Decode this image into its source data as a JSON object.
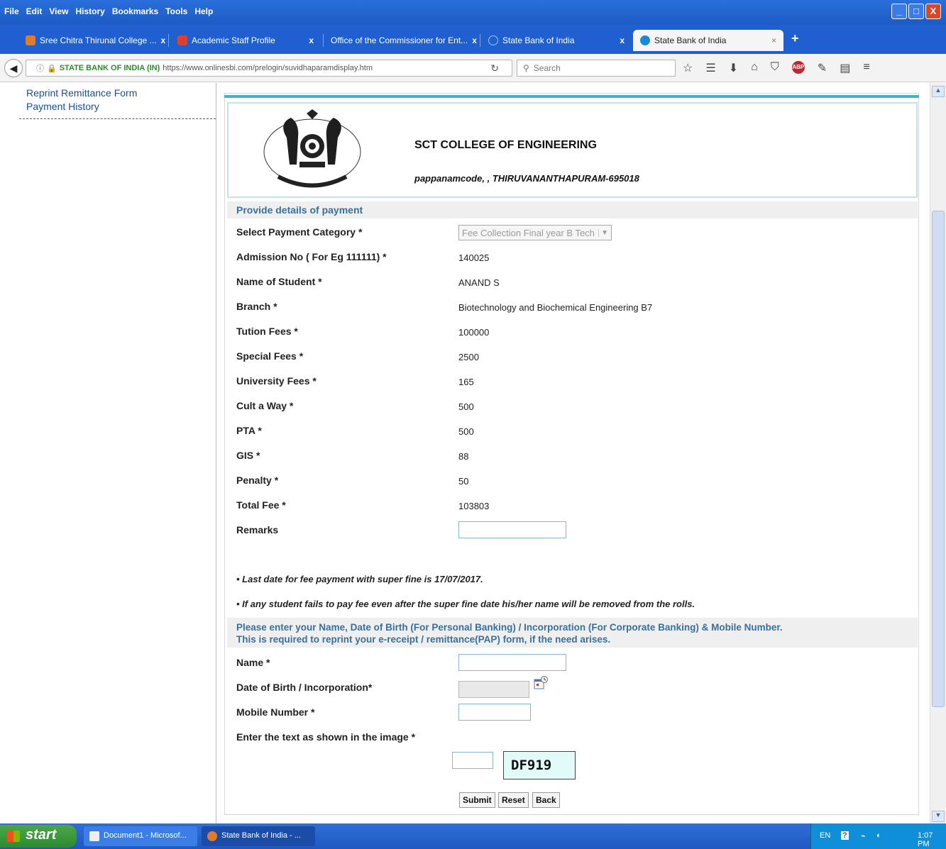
{
  "browser": {
    "menu": [
      "File",
      "Edit",
      "View",
      "History",
      "Bookmarks",
      "Tools",
      "Help"
    ],
    "tabs": [
      {
        "label": "Sree Chitra Thirunal College ...",
        "icon_color": "#e07b2a",
        "active": false
      },
      {
        "label": "Academic Staff Profile",
        "icon_color": "#e0402a",
        "active": false
      },
      {
        "label": "Office of the Commissioner for Ent...",
        "icon_color": "",
        "active": false
      },
      {
        "label": "State Bank of India",
        "icon_color": "#2a6fdc",
        "active": false
      },
      {
        "label": "State Bank of India",
        "icon_color": "#1a8ad8",
        "active": true
      }
    ],
    "site_identity": "STATE BANK OF INDIA (IN)",
    "url": "https://www.onlinesbi.com/prelogin/suvidhaparamdisplay.htm",
    "search_placeholder": "Search",
    "abp_label": "ABP"
  },
  "sidebar": {
    "links": [
      "Reprint Remittance Form",
      "Payment History"
    ]
  },
  "header": {
    "college_name": "SCT COLLEGE OF ENGINEERING",
    "address": "pappanamcode, , THIRUVANANTHAPURAM-695018"
  },
  "payment": {
    "section_title": "Provide details of payment",
    "category_label": "Select Payment Category *",
    "category_value": "Fee Collection Final year B Tech",
    "fields": [
      {
        "label": "Admission No ( For Eg 111111) *",
        "value": "140025"
      },
      {
        "label": "Name of Student *",
        "value": "ANAND S"
      },
      {
        "label": "Branch *",
        "value": "Biotechnology and Biochemical Engineering B7"
      },
      {
        "label": "Tution Fees *",
        "value": "100000"
      },
      {
        "label": "Special Fees *",
        "value": "2500"
      },
      {
        "label": "University Fees *",
        "value": "165"
      },
      {
        "label": "Cult a Way *",
        "value": "500"
      },
      {
        "label": "PTA *",
        "value": "500"
      },
      {
        "label": "GIS *",
        "value": "88"
      },
      {
        "label": "Penalty *",
        "value": "50"
      },
      {
        "label": "Total Fee *",
        "value": "103803"
      }
    ],
    "remarks_label": "Remarks",
    "remarks_value": ""
  },
  "notes": [
    "Last date for fee payment with super fine is 17/07/2017.",
    "If any student fails to pay fee even after the super fine date his/her name will be removed from the rolls."
  ],
  "personal": {
    "section_line1": "Please enter your Name, Date of Birth (For Personal Banking) / Incorporation (For Corporate Banking)  & Mobile Number.",
    "section_line2": "This is required to reprint your e-receipt / remittance(PAP) form, if the need arises.",
    "name_label": "Name *",
    "dob_label": "Date of Birth / Incorporation*",
    "mobile_label": "Mobile Number *",
    "captcha_label": "Enter the text as shown in the image *",
    "captcha_text": "DF919"
  },
  "buttons": {
    "submit": "Submit",
    "reset": "Reset",
    "back": "Back"
  },
  "taskbar": {
    "start": "start",
    "items": [
      "Document1 - Microsof...",
      "State Bank of India - ..."
    ],
    "language": "EN",
    "time": "1:07 PM"
  }
}
